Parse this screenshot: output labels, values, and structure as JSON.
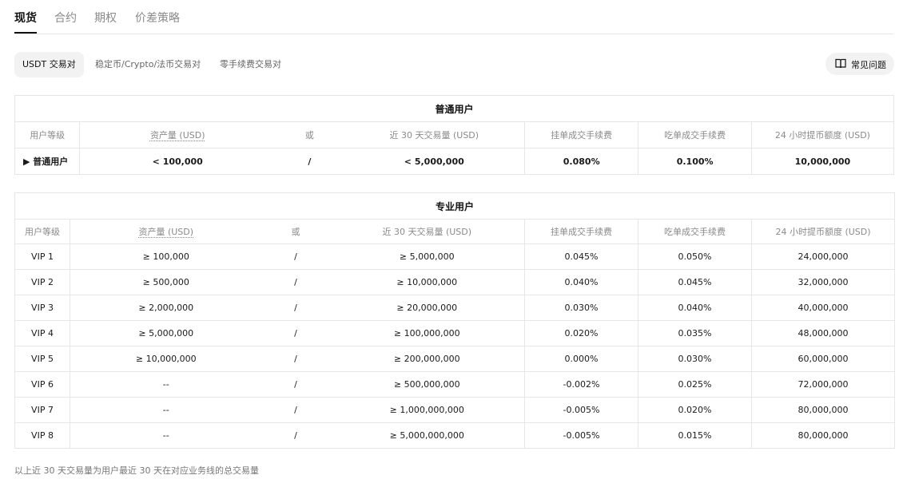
{
  "tabs": [
    "现货",
    "合约",
    "期权",
    "价差策略"
  ],
  "subtabs": [
    "USDT 交易对",
    "稳定币/Crypto/法币交易对",
    "零手续费交易对"
  ],
  "faq_label": "常见问题",
  "regular": {
    "title": "普通用户",
    "headers": [
      "用户等级",
      "资产量 (USD)",
      "或",
      "近 30 天交易量 (USD)",
      "挂单成交手续费",
      "吃单成交手续费",
      "24 小时提币额度 (USD)"
    ],
    "row": [
      "▶ 普通用户",
      "< 100,000",
      "/",
      "< 5,000,000",
      "0.080%",
      "0.100%",
      "10,000,000"
    ]
  },
  "pro": {
    "title": "专业用户",
    "headers": [
      "用户等级",
      "资产量 (USD)",
      "或",
      "近 30 天交易量 (USD)",
      "挂单成交手续费",
      "吃单成交手续费",
      "24 小时提币额度 (USD)"
    ],
    "rows": [
      [
        "VIP 1",
        "≥ 100,000",
        "/",
        "≥ 5,000,000",
        "0.045%",
        "0.050%",
        "24,000,000"
      ],
      [
        "VIP 2",
        "≥ 500,000",
        "/",
        "≥ 10,000,000",
        "0.040%",
        "0.045%",
        "32,000,000"
      ],
      [
        "VIP 3",
        "≥ 2,000,000",
        "/",
        "≥ 20,000,000",
        "0.030%",
        "0.040%",
        "40,000,000"
      ],
      [
        "VIP 4",
        "≥ 5,000,000",
        "/",
        "≥ 100,000,000",
        "0.020%",
        "0.035%",
        "48,000,000"
      ],
      [
        "VIP 5",
        "≥ 10,000,000",
        "/",
        "≥ 200,000,000",
        "0.000%",
        "0.030%",
        "60,000,000"
      ],
      [
        "VIP 6",
        "--",
        "/",
        "≥ 500,000,000",
        "-0.002%",
        "0.025%",
        "72,000,000"
      ],
      [
        "VIP 7",
        "--",
        "/",
        "≥ 1,000,000,000",
        "-0.005%",
        "0.020%",
        "80,000,000"
      ],
      [
        "VIP 8",
        "--",
        "/",
        "≥ 5,000,000,000",
        "-0.005%",
        "0.015%",
        "80,000,000"
      ]
    ]
  },
  "footnote": "以上近 30 天交易量为用户最近 30 天在对应业务线的总交易量"
}
